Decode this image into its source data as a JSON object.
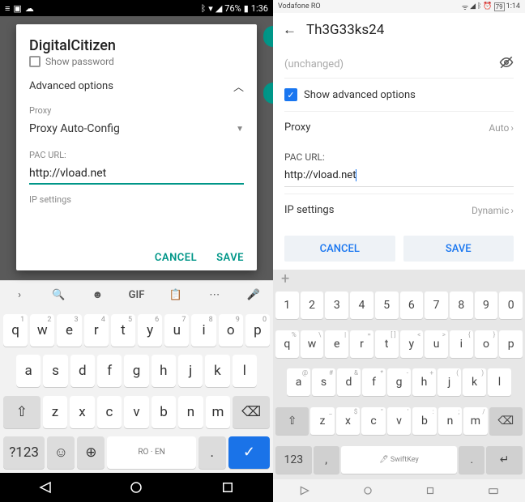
{
  "left": {
    "status": {
      "battery": "76%",
      "time": "1:36"
    },
    "dialog": {
      "title": "DigitalCitizen",
      "show_password": "Show password",
      "advanced": "Advanced options",
      "proxy_label": "Proxy",
      "proxy_value": "Proxy Auto-Config",
      "pac_label": "PAC URL:",
      "pac_value": "http://vload.net",
      "ip_label": "IP settings",
      "cancel": "CANCEL",
      "save": "SAVE"
    },
    "kb": {
      "gif": "GIF",
      "row1": [
        "q",
        "w",
        "e",
        "r",
        "t",
        "y",
        "u",
        "i",
        "o",
        "p"
      ],
      "sup1": [
        "1",
        "2",
        "3",
        "4",
        "5",
        "6",
        "7",
        "8",
        "9",
        "0"
      ],
      "row2": [
        "a",
        "s",
        "d",
        "f",
        "g",
        "h",
        "j",
        "k",
        "l"
      ],
      "row3": [
        "z",
        "x",
        "c",
        "v",
        "b",
        "n",
        "m"
      ],
      "sym": "?123",
      "space": "RO · EN",
      "period": "."
    }
  },
  "right": {
    "status": {
      "carrier": "Vodafone RO",
      "time": "1:14",
      "battery": "79"
    },
    "header": "Th3G33ks24",
    "password_placeholder": "(unchanged)",
    "adv_label": "Show advanced options",
    "proxy_label": "Proxy",
    "proxy_value": "Auto",
    "pac_label": "PAC URL:",
    "pac_value": "http://vload.net",
    "ip_label": "IP settings",
    "ip_value": "Dynamic",
    "cancel": "CANCEL",
    "save": "SAVE",
    "kb": {
      "numrow": [
        "1",
        "2",
        "3",
        "4",
        "5",
        "6",
        "7",
        "8",
        "9",
        "0"
      ],
      "row1": [
        "q",
        "w",
        "e",
        "r",
        "t",
        "y",
        "u",
        "i",
        "o",
        "p"
      ],
      "sup1": [
        "%",
        "\\",
        "|",
        "=",
        "[ ]",
        "<",
        ">",
        "{",
        "}"
      ],
      "row2": [
        "a",
        "s",
        "d",
        "f",
        "g",
        "h",
        "j",
        "k",
        "l"
      ],
      "sub2": [
        "@",
        "#",
        "&",
        "*",
        "-",
        "+",
        "(",
        ")"
      ],
      "row3": [
        "z",
        "x",
        "c",
        "v",
        "b",
        "n",
        "m"
      ],
      "sub3": [
        "_",
        "$",
        "\"",
        "'",
        ":",
        ";",
        "/"
      ],
      "sym": "123",
      "comma": ",",
      "period": ".",
      "space": "SwiftKey"
    }
  }
}
